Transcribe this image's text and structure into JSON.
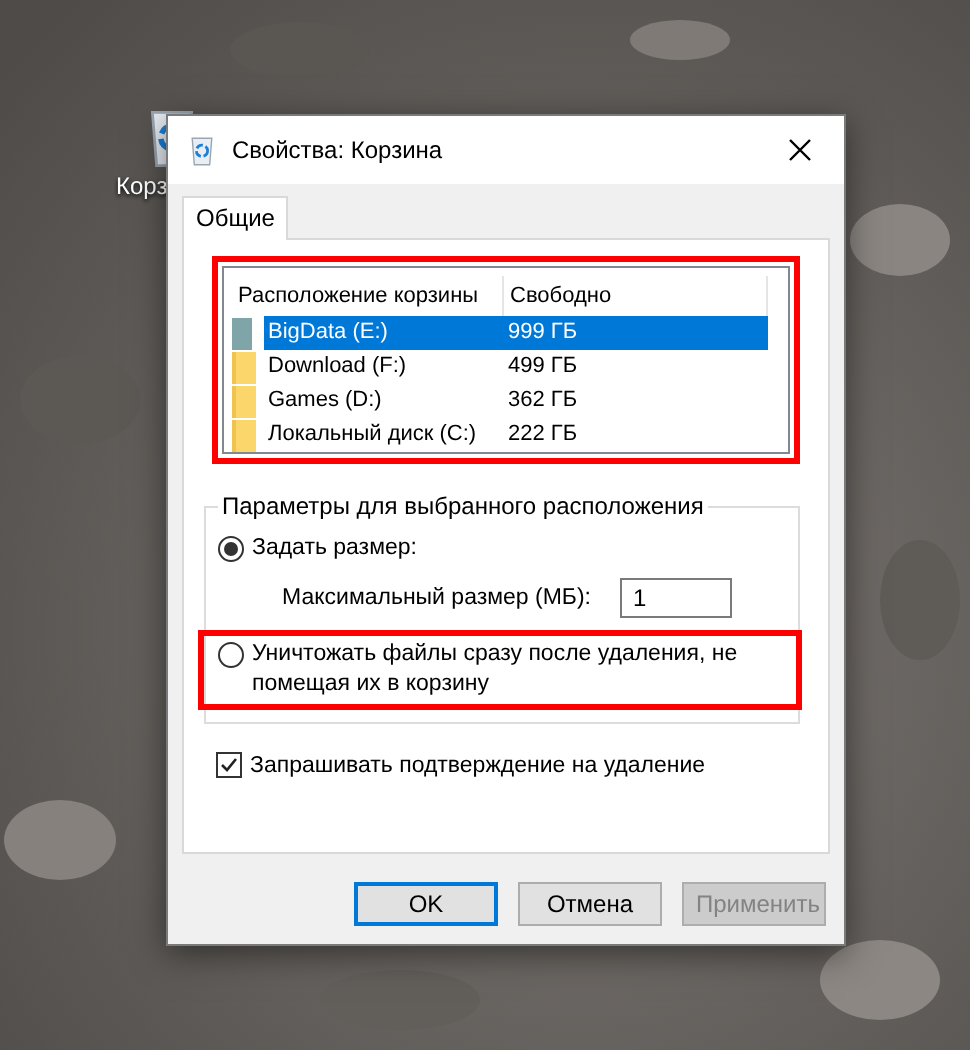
{
  "desktop": {
    "icons": [
      {
        "label": "Корз"
      }
    ]
  },
  "dialog": {
    "title": "Свойства: Корзина",
    "tabs": [
      {
        "label": "Общие",
        "selected": true
      }
    ],
    "locations": {
      "highlighted": true,
      "columns": [
        "Расположение корзины",
        "Свободно"
      ],
      "rows": [
        {
          "name": "BigData (E:)",
          "free": "999 ГБ",
          "selected": true,
          "kind": "drive"
        },
        {
          "name": "Download (F:)",
          "free": "499 ГБ",
          "selected": false,
          "kind": "folder"
        },
        {
          "name": "Games (D:)",
          "free": "362 ГБ",
          "selected": false,
          "kind": "folder"
        },
        {
          "name": "Локальный диск (C:)",
          "free": "222 ГБ",
          "selected": false,
          "kind": "folder"
        }
      ]
    },
    "settings": {
      "title": "Параметры для выбранного расположения",
      "options": [
        {
          "label": "Задать размер:",
          "selected": true,
          "highlighted": false
        },
        {
          "label": "Уничтожать файлы сразу после удаления, не помещая их в корзину",
          "selected": false,
          "highlighted": true
        }
      ],
      "max_size": {
        "label": "Максимальный размер (МБ):",
        "value": "1"
      }
    },
    "confirm": {
      "label": "Запрашивать подтверждение на удаление",
      "checked": true
    },
    "buttons": [
      {
        "label": "OK",
        "default": true,
        "disabled": false
      },
      {
        "label": "Отмена",
        "default": false,
        "disabled": false
      },
      {
        "label": "Применить",
        "default": false,
        "disabled": true
      }
    ]
  }
}
